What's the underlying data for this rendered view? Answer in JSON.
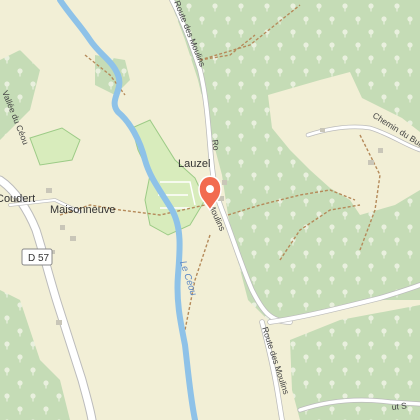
{
  "map": {
    "places": {
      "lauzel": "Lauzel",
      "maisonneuve": "Maisonneuve",
      "coudert": "Coudert"
    },
    "roads": {
      "d57_shield": "D 57",
      "route_des_moulins_north": "Route des Moulins",
      "route_des_moulins_south": "Route des Moulins",
      "chemin_du_but": "Chemin du But",
      "vallee_du_ceou": "Vallée du Céou",
      "partial_bottom_right": "ut S"
    },
    "water": {
      "river_name": "Le Céou"
    },
    "marker": {
      "icon": "map-pin-icon",
      "color": "#f26b4f"
    },
    "colors": {
      "forest": "#c5dcb6",
      "forest_tree": "#e9f0de",
      "field": "#f2efd6",
      "park": "#d8ecbc",
      "water": "#8ec2e8",
      "road": "#ffffff",
      "trail": "#b58a5a"
    }
  }
}
